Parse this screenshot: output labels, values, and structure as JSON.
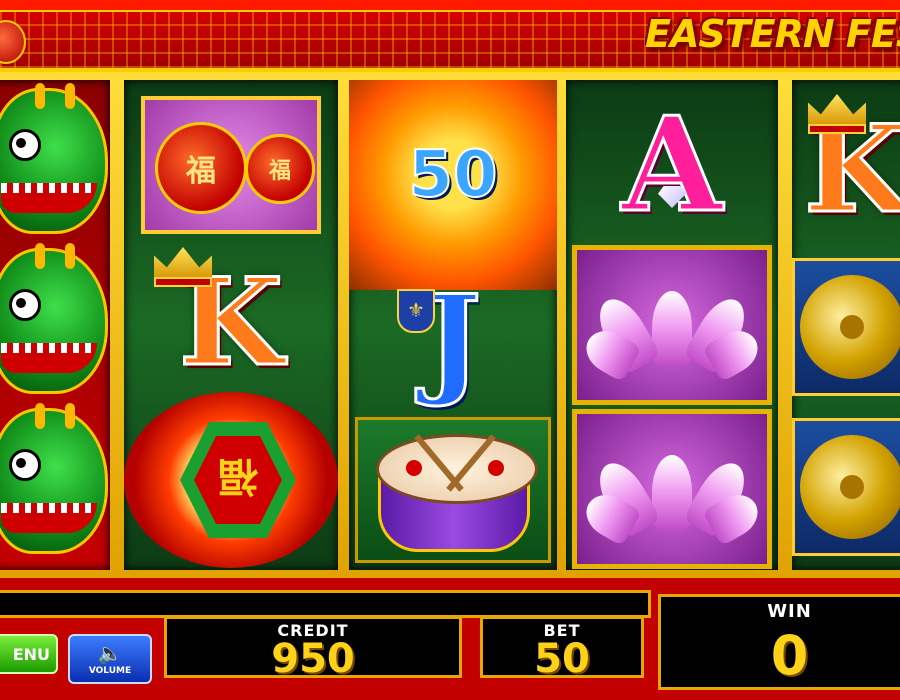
{
  "game": {
    "title": "EASTERN FES"
  },
  "reels": {
    "reel2": {
      "king": "K"
    },
    "reel3": {
      "bonus_value": "50",
      "jack": "J"
    },
    "reel4": {
      "ace": "A"
    },
    "reel5": {
      "king": "K"
    }
  },
  "symbol_glyphs": {
    "fu": "福",
    "fu_inverted": "福"
  },
  "controls": {
    "menu_label": "ENU",
    "volume_label": "VOLUME"
  },
  "meters": {
    "credit_label": "CREDIT",
    "credit_value": "950",
    "bet_label": "BET",
    "bet_value": "50",
    "win_label": "WIN",
    "win_value": "0"
  },
  "colors": {
    "frame_red": "#c30000",
    "gold": "#e6a800",
    "meter_text": "#ffd21a"
  }
}
